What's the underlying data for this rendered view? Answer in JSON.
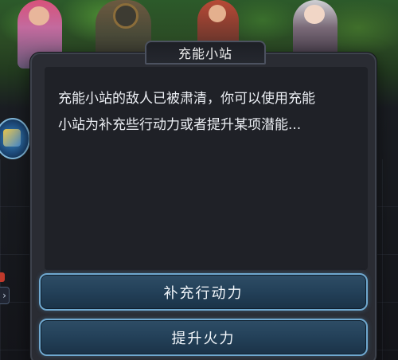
{
  "dialog": {
    "title": "充能小站",
    "message_line1": "充能小站的敌人已被肃清，你可以使用充能",
    "message_line2": "小站为补充些行动力或者提升某项潜能..."
  },
  "actions": [
    {
      "label": "补充行动力"
    },
    {
      "label": "提升火力"
    }
  ],
  "colors": {
    "dialog_bg": "#2a2c33",
    "message_bg": "#1f2127",
    "button_fill": "#223f57",
    "button_border": "#6fa8cf",
    "text": "#eceff4"
  },
  "icons": {
    "side_left": "charge-station-icon",
    "side_tab": "chevron-right-icon"
  }
}
